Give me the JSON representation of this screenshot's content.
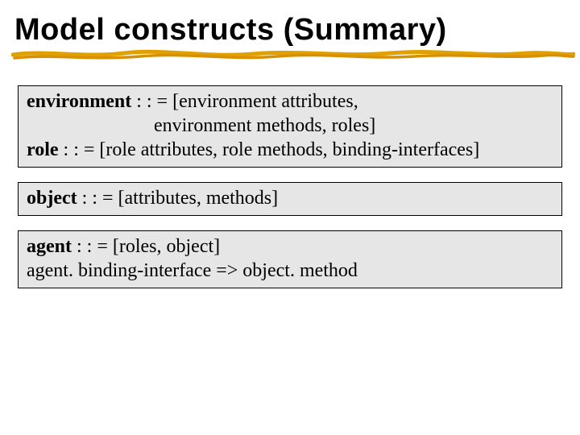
{
  "title": "Model constructs  (Summary)",
  "box1": {
    "l1a": "environment",
    "l1b": " : : = [environment attributes,",
    "l2": "environment methods, roles]",
    "l3a": "role",
    "l3b": " : : = [role attributes, role methods, binding-interfaces]"
  },
  "box2": {
    "l1a": "object",
    "l1b": " : : = [attributes, methods]"
  },
  "box3": {
    "l1a": "agent",
    "l1b": " : : = [roles, object]",
    "l2": "agent. binding-interface => object. method"
  }
}
